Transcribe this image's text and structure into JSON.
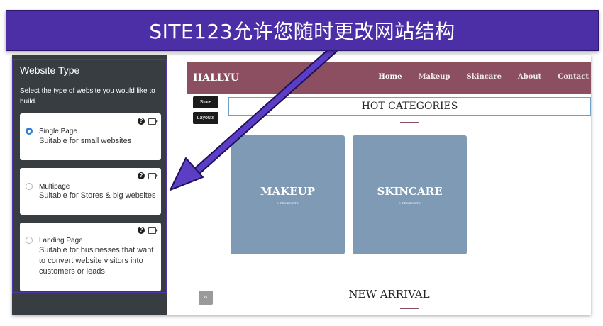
{
  "banner": {
    "text": "SITE123允许您随时更改网站结构"
  },
  "sidebar": {
    "title": "Website Type",
    "description": "Select the type of website you would like to build.",
    "options": [
      {
        "title": "Single Page",
        "subtitle": "Suitable for small websites",
        "selected": true
      },
      {
        "title": "Multipage",
        "subtitle": "Suitable for Stores & big websites",
        "selected": false
      },
      {
        "title": "Landing Page",
        "subtitle": "Suitable for businesses that want to convert website visitors into customers or leads",
        "selected": false
      }
    ]
  },
  "site": {
    "logo": "HALLYU",
    "nav": [
      "Home",
      "Makeup",
      "Skincare",
      "About",
      "Contact"
    ],
    "side_buttons": [
      "Store",
      "Layouts"
    ],
    "hot_title": "HOT CATEGORIES",
    "categories": [
      {
        "name": "MAKEUP",
        "count": "0 PRODUCTS"
      },
      {
        "name": "SKINCARE",
        "count": "0 PRODUCTS"
      }
    ],
    "new_title": "NEW ARRIVAL",
    "scroll_up": "^"
  },
  "colors": {
    "banner": "#4c2ea6",
    "header": "#8c4f62",
    "category_card": "#7e9ab4",
    "sidebar_bg": "#373d40",
    "radio_selected": "#2f7de0"
  }
}
